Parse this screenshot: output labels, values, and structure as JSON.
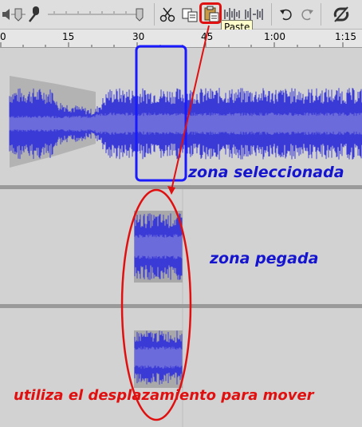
{
  "toolbar": {
    "tooltip": "Paste",
    "buttons": [
      "cut-icon",
      "copy-icon",
      "paste-icon",
      "trim-icon",
      "silence-icon",
      "undo-icon",
      "redo-icon",
      "sync-lock-icon"
    ]
  },
  "ruler": {
    "ticks": [
      "0",
      "15",
      "30",
      "45",
      "1:00",
      "1:15"
    ]
  },
  "annotations": {
    "selected_zone": "zona seleccionada",
    "pasted_zone": "zona pegada",
    "instruction": "utiliza el desplazamiento para mover"
  },
  "colors": {
    "waveform": "#3a3ad6",
    "waveform_rms": "#6b6bdc",
    "selection_box": "#1a1aff",
    "annotation_blue": "#1515d0",
    "annotation_red": "#e01010",
    "highlight_red": "#e01010"
  }
}
